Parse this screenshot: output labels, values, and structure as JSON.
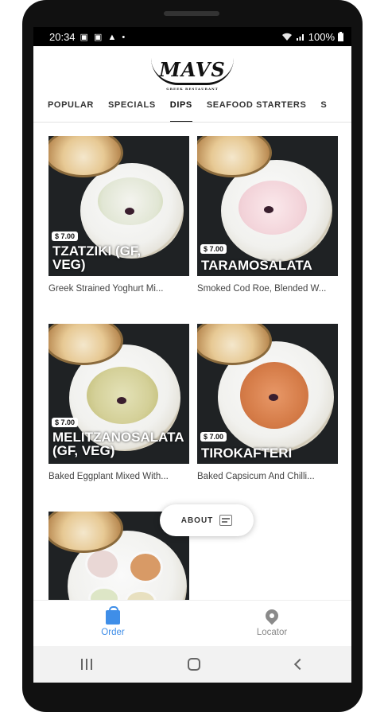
{
  "status_bar": {
    "time": "20:34",
    "icons": "▣ ▣ ▲ •",
    "battery": "100%"
  },
  "header": {
    "logo_text": "MAVS",
    "logo_subtext": "GREEK RESTAURANT"
  },
  "tabs": [
    {
      "label": "POPULAR"
    },
    {
      "label": "SPECIALS"
    },
    {
      "label": "DIPS"
    },
    {
      "label": "SEAFOOD STARTERS"
    },
    {
      "label": "S"
    }
  ],
  "active_tab": "DIPS",
  "menu_items": [
    {
      "price": "$ 7.00",
      "name": "TZATZIKI (GF,\nVEG)",
      "description": "Greek Strained Yoghurt Mi..."
    },
    {
      "price": "$ 7.00",
      "name": "TARAMOSALATA",
      "description": "Smoked Cod Roe, Blended W..."
    },
    {
      "price": "$ 7.00",
      "name": "MELITZANOSALATA\n(GF, VEG)",
      "description": "Baked Eggplant Mixed With..."
    },
    {
      "price": "$ 7.00",
      "name": "TIROKAFTERI",
      "description": "Baked Capsicum And Chilli..."
    }
  ],
  "about_button": {
    "label": "ABOUT"
  },
  "bottom_nav": [
    {
      "label": "Order",
      "icon": "shopping-bag-icon",
      "active": true
    },
    {
      "label": "Locator",
      "icon": "location-pin-icon",
      "active": false
    }
  ],
  "colors": {
    "accent": "#3f8ee8",
    "text": "#111111"
  }
}
